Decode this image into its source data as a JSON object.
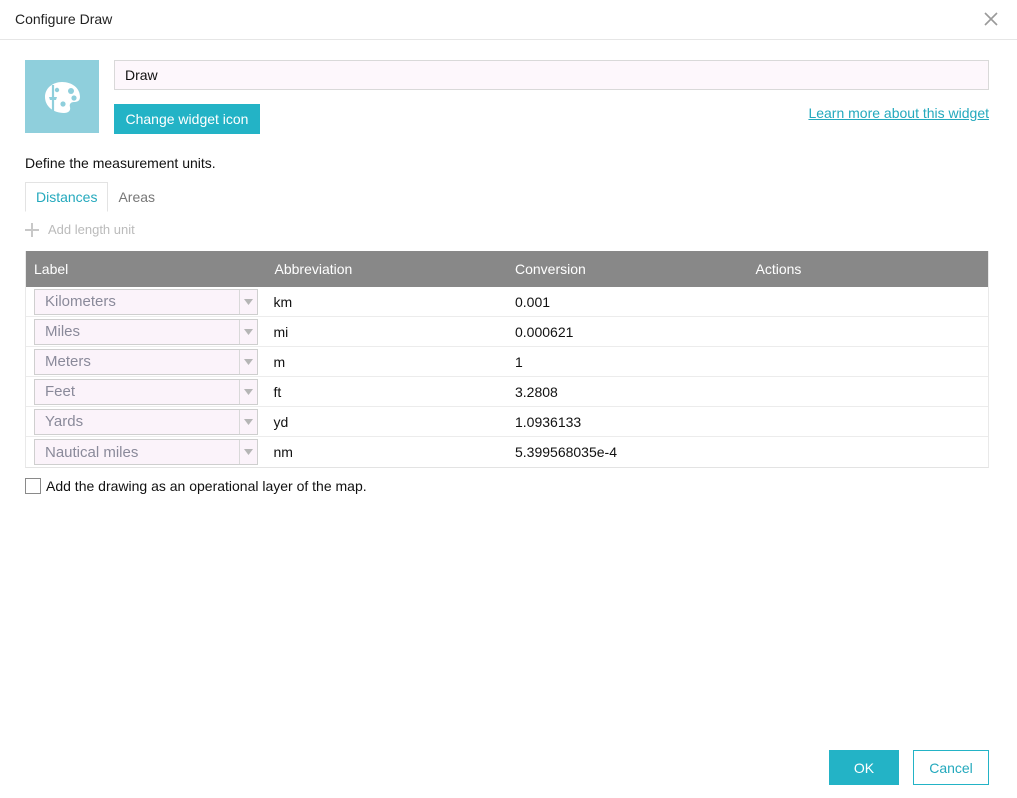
{
  "dialog": {
    "title": "Configure Draw",
    "close_icon": "close-icon"
  },
  "widget": {
    "icon": "palette-icon",
    "icon_bg_color": "#8fcfdc",
    "name_value": "Draw",
    "change_icon_label": "Change widget icon",
    "learn_more_label": "Learn more about this widget"
  },
  "units": {
    "instructions": "Define the measurement units.",
    "tabs": [
      {
        "label": "Distances",
        "active": true
      },
      {
        "label": "Areas",
        "active": false
      }
    ],
    "add_label": "Add length unit",
    "columns": [
      "Label",
      "Abbreviation",
      "Conversion",
      "Actions"
    ],
    "rows": [
      {
        "label": "Kilometers",
        "abbreviation": "km",
        "conversion": "0.001"
      },
      {
        "label": "Miles",
        "abbreviation": "mi",
        "conversion": "0.000621"
      },
      {
        "label": "Meters",
        "abbreviation": "m",
        "conversion": "1"
      },
      {
        "label": "Feet",
        "abbreviation": "ft",
        "conversion": "3.2808"
      },
      {
        "label": "Yards",
        "abbreviation": "yd",
        "conversion": "1.0936133"
      },
      {
        "label": "Nautical miles",
        "abbreviation": "nm",
        "conversion": "5.399568035e-4"
      }
    ]
  },
  "options": {
    "operational_layer_label": "Add the drawing as an operational layer of the map.",
    "operational_layer_checked": false
  },
  "footer": {
    "ok_label": "OK",
    "cancel_label": "Cancel"
  },
  "colors": {
    "accent": "#23b3c6",
    "header_gray": "#888888"
  }
}
